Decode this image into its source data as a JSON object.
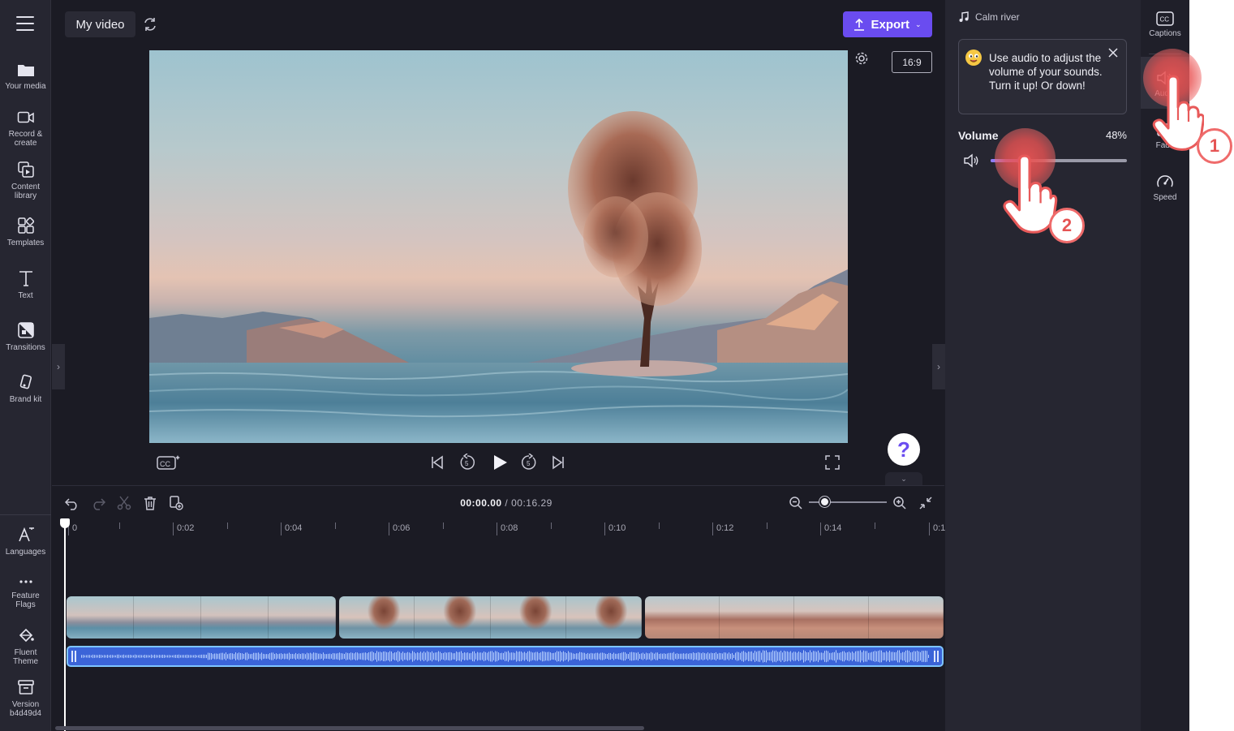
{
  "top_bar": {
    "project_name": "My video",
    "export_label": "Export"
  },
  "left_nav": {
    "items": [
      {
        "label": "Your media",
        "icon": "folder-icon"
      },
      {
        "label": "Record & create",
        "icon": "camera-icon"
      },
      {
        "label": "Content library",
        "icon": "library-icon"
      },
      {
        "label": "Templates",
        "icon": "templates-icon"
      },
      {
        "label": "Text",
        "icon": "text-icon"
      },
      {
        "label": "Transitions",
        "icon": "transitions-icon"
      },
      {
        "label": "Brand kit",
        "icon": "brand-kit-icon"
      }
    ],
    "bottom_items": [
      {
        "label": "Languages",
        "icon": "languages-icon"
      },
      {
        "label": "Feature Flags",
        "icon": "more-icon"
      },
      {
        "label": "Fluent Theme",
        "icon": "paint-bucket-icon"
      },
      {
        "label": "Version b4d49d4",
        "icon": "archive-icon"
      }
    ]
  },
  "preview": {
    "aspect_ratio": "16:9"
  },
  "help_label": "?",
  "timeline": {
    "current_time": "00:00.00",
    "separator": "/",
    "total_time": "00:16.29",
    "ruler_labels": [
      "0",
      "0:02",
      "0:04",
      "0:06",
      "0:08",
      "0:10",
      "0:12",
      "0:14",
      "0:1"
    ],
    "zoom_level": 0.2
  },
  "properties": {
    "clip_title": "Calm river",
    "tip_text": "Use audio to adjust the volume of your sounds. Turn it up! Or down!",
    "volume_label": "Volume",
    "volume_value": "48%",
    "volume_level": 0.24
  },
  "tools": {
    "items": [
      {
        "label": "Captions",
        "icon": "captions-icon"
      },
      {
        "label": "Audio",
        "icon": "audio-icon"
      },
      {
        "label": "Fade",
        "icon": "fade-icon"
      },
      {
        "label": "Speed",
        "icon": "speed-icon"
      }
    ]
  },
  "tutorial": {
    "step_1": "1",
    "step_2": "2"
  },
  "colors": {
    "accent": "#6a4cf0",
    "audio_track": "#3b64d8",
    "tutorial_highlight": "#e95454"
  }
}
